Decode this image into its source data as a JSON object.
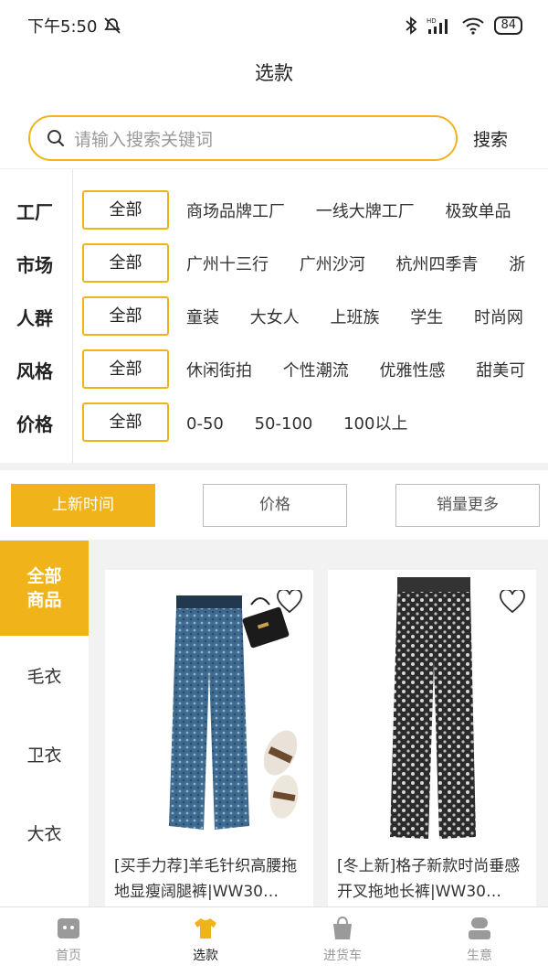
{
  "status": {
    "time": "下午5:50",
    "battery": "84",
    "hd": "HD"
  },
  "title": "选款",
  "search": {
    "placeholder": "请输入搜索关键词",
    "button": "搜索"
  },
  "filters": [
    {
      "name": "工厂",
      "all": "全部",
      "options": [
        "商场品牌工厂",
        "一线大牌工厂",
        "极致单品"
      ]
    },
    {
      "name": "市场",
      "all": "全部",
      "options": [
        "广州十三行",
        "广州沙河",
        "杭州四季青",
        "浙"
      ]
    },
    {
      "name": "人群",
      "all": "全部",
      "options": [
        "童装",
        "大女人",
        "上班族",
        "学生",
        "时尚网"
      ]
    },
    {
      "name": "风格",
      "all": "全部",
      "options": [
        "休闲街拍",
        "个性潮流",
        "优雅性感",
        "甜美可"
      ]
    },
    {
      "name": "价格",
      "all": "全部",
      "options": [
        "0-50",
        "50-100",
        "100以上"
      ]
    }
  ],
  "sort": {
    "new": "上新时间",
    "price": "价格",
    "sales": "销量更多"
  },
  "categories": {
    "all_line1": "全部",
    "all_line2": "商品",
    "items": [
      "毛衣",
      "卫衣",
      "大衣"
    ]
  },
  "products": [
    {
      "title": "[买手力荐]羊毛针织高腰拖地显瘦阔腿裤|WW30…"
    },
    {
      "title": "[冬上新]格子新款时尚垂感开叉拖地长裤|WW30…"
    }
  ],
  "tabs": [
    "首页",
    "选款",
    "进货车",
    "生意"
  ],
  "colors": {
    "accent": "#f0b31a"
  }
}
